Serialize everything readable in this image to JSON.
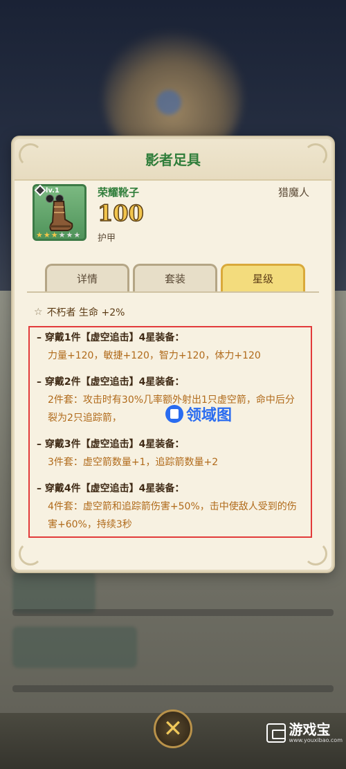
{
  "panel": {
    "title": "影者足具"
  },
  "item": {
    "level": "lv.1",
    "name": "荣耀靴子",
    "class": "猎魔人",
    "armor_value": "100",
    "armor_label": "护甲",
    "stars_filled": 3,
    "stars_total": 6
  },
  "tabs": [
    {
      "label": "详情",
      "active": false
    },
    {
      "label": "套装",
      "active": false
    },
    {
      "label": "星级",
      "active": true
    }
  ],
  "star_bonus": "不朽者 生命 +2%",
  "set_entries": [
    {
      "head": "– 穿戴1件【虚空追击】4星装备：",
      "desc": "力量+120，敏捷+120，智力+120，体力+120"
    },
    {
      "head": "– 穿戴2件【虚空追击】4星装备：",
      "desc": "2件套：攻击时有30%几率额外射出1只虚空箭，命中后分裂为2只追踪箭，"
    },
    {
      "head": "– 穿戴3件【虚空追击】4星装备：",
      "desc": "3件套：虚空箭数量+1，追踪箭数量+2"
    },
    {
      "head": "– 穿戴4件【虚空追击】4星装备：",
      "desc": "4件套：虚空箭和追踪箭伤害+50%，击中使敌人受到的伤害+60%，持续3秒"
    }
  ],
  "overlay_logo": "领域图",
  "watermark": {
    "title": "游戏宝",
    "sub": "www.youxibao.com"
  },
  "close_icon": "close-x-icon"
}
